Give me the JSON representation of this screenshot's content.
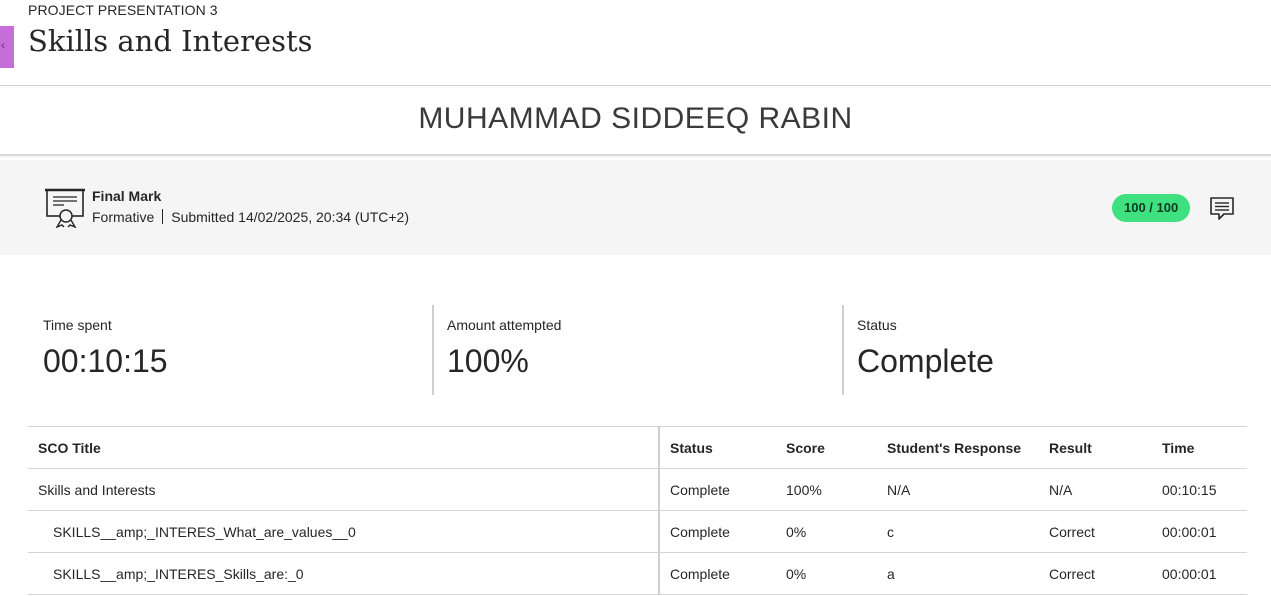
{
  "header": {
    "breadcrumb": "PROJECT PRESENTATION 3",
    "title": "Skills and Interests",
    "accent_color": "#c56dd8"
  },
  "student": {
    "name": "MUHAMMAD SIDDEEQ RABIN"
  },
  "grade": {
    "label": "Final Mark",
    "type": "Formative",
    "submitted": "Submitted 14/02/2025, 20:34 (UTC+2)",
    "score": "100 / 100",
    "score_color": "#3ee07f",
    "icon": "certificate-icon",
    "feedback_icon": "feedback-icon"
  },
  "stats": [
    {
      "label": "Time spent",
      "value": "00:10:15"
    },
    {
      "label": "Amount attempted",
      "value": "100%"
    },
    {
      "label": "Status",
      "value": "Complete"
    }
  ],
  "table": {
    "columns": [
      "SCO Title",
      "Status",
      "Score",
      "Student's Response",
      "Result",
      "Time"
    ],
    "rows": [
      [
        "Skills and Interests",
        "Complete",
        "100%",
        "N/A",
        "N/A",
        "00:10:15"
      ],
      [
        "SKILLS__amp;_INTERES_What_are_values__0",
        "Complete",
        "0%",
        "c",
        "Correct",
        "00:00:01"
      ],
      [
        "SKILLS__amp;_INTERES_Skills_are:_0",
        "Complete",
        "0%",
        "a",
        "Correct",
        "00:00:01"
      ]
    ]
  }
}
